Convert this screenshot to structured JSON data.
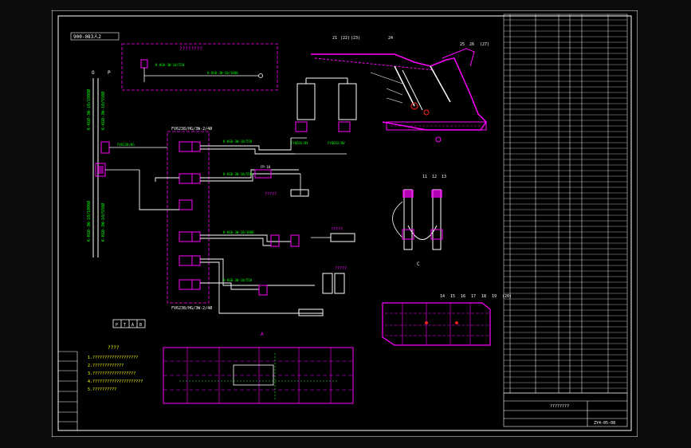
{
  "drawing": {
    "top_label": "900-083人2",
    "title_block": [
      "????????",
      "ZY4-05-08"
    ],
    "scheme_title": "????????",
    "circuit_labels": {
      "hose_main": "K-KG0-3W-10/1000Ø",
      "hose_mid": "K-KG0-3W-10/550Ø",
      "valve_top": "FV6238/HG/3W-2/4Ø",
      "valve_bottom": "FV6238/HG/3W-2/4Ø",
      "pump_label": "?????",
      "cyl_label": "?????",
      "cyl_label2": "?????",
      "cyl_label3": "?????",
      "orifice": "FP-10",
      "pressure_block": "FY6D32/8V"
    },
    "notes_title": "????",
    "notes_lines": [
      "1.???????????????????",
      "2.?????????????",
      "3.??????????????????",
      "4.?????????????????????",
      "5.??????????"
    ],
    "sections": {
      "A": "A",
      "B": "B",
      "C": "C"
    },
    "balloons_top": [
      "21",
      "(22)",
      "(23)",
      "24",
      "25",
      "26",
      "(27)"
    ],
    "balloons_c": [
      "11",
      "12",
      "13"
    ],
    "balloons_b": [
      "14",
      "15",
      "16",
      "17",
      "18",
      "19",
      "(20)"
    ],
    "legend_marks": [
      "P",
      "T",
      "A",
      "B"
    ],
    "pressure_text": "P",
    "zero_text": "O"
  },
  "colors": {
    "magenta": "#ff00ff",
    "green": "#00ff00",
    "white": "#ffffff",
    "cyan": "#00ffff",
    "yellow": "#ffff00",
    "red": "#ff2020"
  }
}
